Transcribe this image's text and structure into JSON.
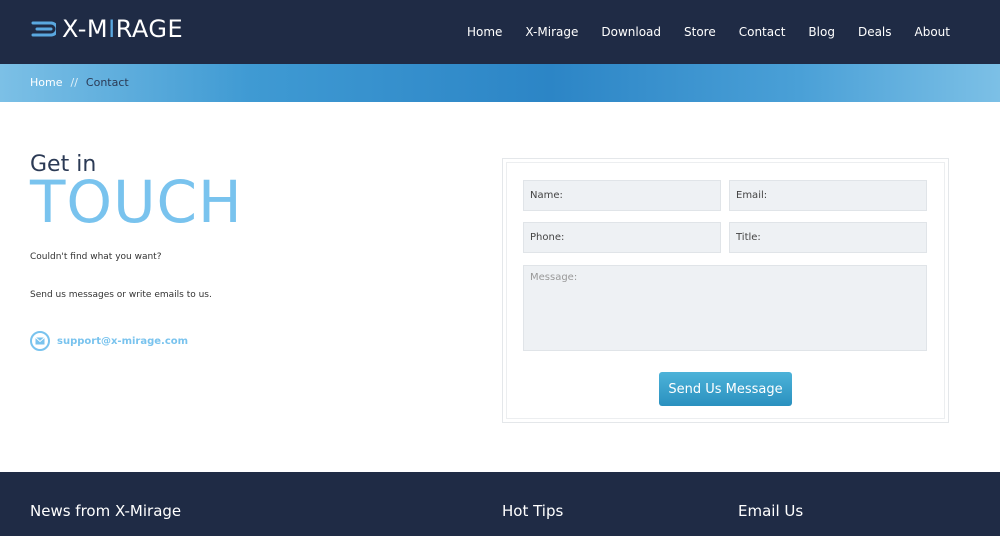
{
  "header": {
    "logo_prefix": "X-M",
    "logo_highlight": "I",
    "logo_suffix": "RAGE",
    "nav": [
      "Home",
      "X-Mirage",
      "Download",
      "Store",
      "Contact",
      "Blog",
      "Deals",
      "About"
    ]
  },
  "breadcrumb": {
    "home": "Home",
    "separator": "//",
    "current": "Contact"
  },
  "intro": {
    "get_in": "Get in",
    "touch": "TOUCH",
    "line1": "Couldn't find what you want?",
    "line2": "Send us messages or write emails to us.",
    "email": "support@x-mirage.com"
  },
  "form": {
    "name_placeholder": "Name:",
    "email_placeholder": "Email:",
    "phone_placeholder": "Phone:",
    "title_placeholder": "Title:",
    "message_placeholder": "Message:",
    "submit_label": "Send Us Message"
  },
  "footer": {
    "col1": "News from X-Mirage",
    "col2": "Hot Tips",
    "col3": "Email Us"
  },
  "colors": {
    "nav_bg": "#1f2b45",
    "accent": "#79c3ee",
    "button": "#2a91bf"
  }
}
